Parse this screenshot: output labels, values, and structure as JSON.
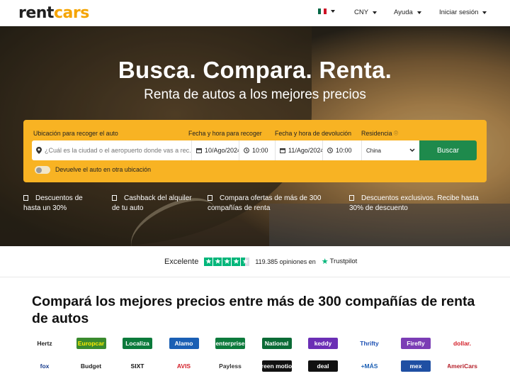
{
  "header": {
    "logo_main_a": "rent",
    "logo_main_b": "cars",
    "currency": "CNY",
    "help": "Ayuda",
    "login": "Iniciar sesión",
    "flag_colors": [
      "#006847",
      "#ffffff",
      "#ce1126"
    ]
  },
  "hero": {
    "title": "Busca. Compara. Renta.",
    "subtitle": "Renta de autos a los mejores precios"
  },
  "search": {
    "pickup_location_label": "Ubicación para recoger el auto",
    "pickup_location_placeholder": "¿Cuál es la ciudad o el aeropuerto donde vas a rec...",
    "pickup_datetime_label": "Fecha y hora para recoger",
    "pickup_date": "10/Ago/2024",
    "pickup_time": "10:00",
    "return_datetime_label": "Fecha y hora de devolución",
    "return_date": "11/Ago/2024",
    "return_time": "10:00",
    "residence_label": "Residencia",
    "residence_value": "China",
    "search_button": "Buscar",
    "return_elsewhere_label": "Devuelve el auto en otra ubicación",
    "return_elsewhere_on": false
  },
  "benefits": [
    {
      "line1": "Descuentos de",
      "line2": "hasta un 30%"
    },
    {
      "line1": "Cashback del alquiler",
      "line2": "de tu auto"
    },
    {
      "line1": "Compara ofertas de más de 300",
      "line2": "compañías de renta"
    },
    {
      "line1": "Descuentos exclusivos. Recibe hasta",
      "line2": "30% de descuento"
    }
  ],
  "rating": {
    "word": "Excelente",
    "stars": 4.5,
    "text": "119.385 opiniones en",
    "brand": "Trustpilot",
    "color": "#00b67a"
  },
  "companies": {
    "title": "Compará los mejores precios entre más de 300 compañías de renta de autos",
    "row1": [
      {
        "name": "Hertz",
        "fg": "#222222",
        "bg": "#ffffff"
      },
      {
        "name": "Europcar",
        "fg": "#ffec00",
        "bg": "#3a8a2e"
      },
      {
        "name": "Localiza",
        "fg": "#ffffff",
        "bg": "#0b7a3b"
      },
      {
        "name": "Alamo",
        "fg": "#ffffff",
        "bg": "#1a5fb4"
      },
      {
        "name": "enterprise",
        "fg": "#ffffff",
        "bg": "#0d7a3c"
      },
      {
        "name": "National",
        "fg": "#ffffff",
        "bg": "#0b6b36"
      },
      {
        "name": "keddy",
        "fg": "#ffffff",
        "bg": "#6b2fb5"
      },
      {
        "name": "Thrifty",
        "fg": "#1b4fb3",
        "bg": "#ffffff"
      },
      {
        "name": "Firefly",
        "fg": "#ffffff",
        "bg": "#7b3db5"
      },
      {
        "name": "dollar.",
        "fg": "#d4202a",
        "bg": "#ffffff"
      }
    ],
    "row2": [
      {
        "name": "fox",
        "fg": "#163b8c",
        "bg": "#ffffff"
      },
      {
        "name": "Budget",
        "fg": "#222222",
        "bg": "#ffffff"
      },
      {
        "name": "SIXT",
        "fg": "#111111",
        "bg": "#ffffff"
      },
      {
        "name": "AVIS",
        "fg": "#d4202a",
        "bg": "#ffffff"
      },
      {
        "name": "Payless",
        "fg": "#333333",
        "bg": "#ffffff"
      },
      {
        "name": "green motion",
        "fg": "#ffffff",
        "bg": "#111111"
      },
      {
        "name": "deal",
        "fg": "#ffffff",
        "bg": "#111111"
      },
      {
        "name": "+MÁS",
        "fg": "#1b5fb4",
        "bg": "#ffffff"
      },
      {
        "name": "mex",
        "fg": "#ffffff",
        "bg": "#1f4fa3"
      },
      {
        "name": "AmeriCars",
        "fg": "#b5202a",
        "bg": "#ffffff"
      }
    ]
  }
}
